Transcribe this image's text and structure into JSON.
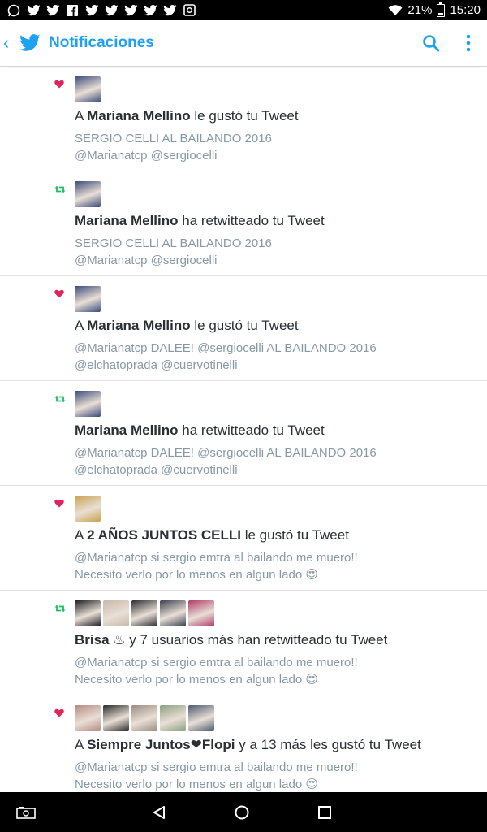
{
  "status_bar": {
    "notification_icons": [
      "whatsapp-icon",
      "twitter-icon",
      "twitter-icon",
      "facebook-icon",
      "twitter-icon",
      "twitter-icon",
      "twitter-icon",
      "twitter-icon",
      "twitter-icon",
      "instagram-icon"
    ],
    "battery": "21%",
    "time": "15:20"
  },
  "app_bar": {
    "title": "Notificaciones",
    "accent": "#1da1f2"
  },
  "notifications": [
    {
      "type": "like",
      "icon": "heart-icon",
      "headline_pre": "A ",
      "headline_bold": "Mariana Mellino",
      "headline_post": " le gustó tu Tweet",
      "line1": "SERGIO CELLI AL BAILANDO 2016",
      "line2": "@Marianatcp @sergiocelli"
    },
    {
      "type": "retweet",
      "icon": "retweet-icon",
      "headline_pre": "",
      "headline_bold": "Mariana Mellino",
      "headline_post": " ha retwitteado tu Tweet",
      "line1": "SERGIO CELLI AL BAILANDO 2016",
      "line2": "@Marianatcp @sergiocelli"
    },
    {
      "type": "like",
      "icon": "heart-icon",
      "headline_pre": "A ",
      "headline_bold": "Mariana Mellino",
      "headline_post": " le gustó tu Tweet",
      "line1": "@Marianatcp DALEE! @sergiocelli  AL BAILANDO 2016",
      "line2": "@elchatoprada @cuervotinelli"
    },
    {
      "type": "retweet",
      "icon": "retweet-icon",
      "headline_pre": "",
      "headline_bold": "Mariana Mellino",
      "headline_post": " ha retwitteado tu Tweet",
      "line1": "@Marianatcp DALEE! @sergiocelli  AL BAILANDO 2016",
      "line2": "@elchatoprada @cuervotinelli"
    },
    {
      "type": "like",
      "icon": "heart-icon",
      "headline_pre": "A ",
      "headline_bold": "2 AÑOS JUNTOS CELLI",
      "headline_post": " le gustó tu Tweet",
      "line1": "@Marianatcp si sergio emtra al bailando me muero!!",
      "line2": "Necesito verlo por lo menos en algun lado 😍"
    },
    {
      "type": "retweet",
      "icon": "retweet-icon",
      "headline_pre": "",
      "headline_bold": "Brisa ♨",
      "headline_post": " y 7 usuarios más han retwitteado tu Tweet",
      "line1": "@Marianatcp si sergio emtra al bailando me muero!!",
      "line2": "Necesito verlo por lo menos en algun lado 😍"
    },
    {
      "type": "like",
      "icon": "heart-icon",
      "headline_pre": "A ",
      "headline_bold": "Siempre Juntos❤Flopi",
      "headline_post": " y a 13 más les gustó tu Tweet",
      "line1": "@Marianatcp si sergio emtra al bailando me muero!!",
      "line2": "Necesito verlo por lo menos en algun lado 😍"
    }
  ],
  "avatar_colors": [
    [
      "#3b4a7a"
    ],
    [
      "#3b4a7a"
    ],
    [
      "#3b4a7a"
    ],
    [
      "#3b4a7a"
    ],
    [
      "#c9a24a"
    ],
    [
      "#1b1b22",
      "#c8b9a9",
      "#2c2c33",
      "#3a4050",
      "#b03a6a"
    ],
    [
      "#b58a80",
      "#2a2a2a",
      "#9a8c80",
      "#8aa080",
      "#4a5a70"
    ]
  ],
  "colors": {
    "like": "#e0245e",
    "retweet": "#17bf63",
    "muted": "#8899a6"
  }
}
